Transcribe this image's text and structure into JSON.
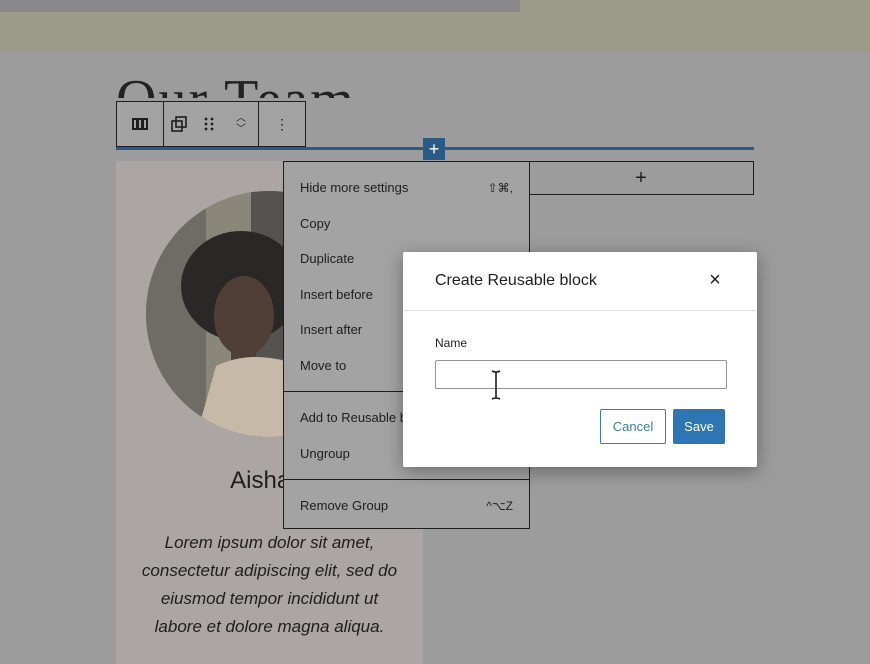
{
  "editor": {
    "heading": "Our Team",
    "appender_label": "+",
    "inserter_label": "+"
  },
  "toolbar": {
    "parent_icon": "columns-icon",
    "block_icon": "reusable-icon",
    "drag_icon": "drag-handle-icon",
    "more_label": "⋮"
  },
  "card": {
    "name": "Aisha J",
    "bio": "Lorem ipsum dolor sit amet, consectetur adipiscing elit, sed do eiusmod tempor incididunt ut labore et dolore magna aliqua."
  },
  "menu": {
    "groups": [
      {
        "items": [
          {
            "label": "Hide more settings",
            "shortcut": "⇧⌘,"
          },
          {
            "label": "Copy",
            "shortcut": ""
          },
          {
            "label": "Duplicate",
            "shortcut": ""
          },
          {
            "label": "Insert before",
            "shortcut": ""
          },
          {
            "label": "Insert after",
            "shortcut": ""
          },
          {
            "label": "Move to",
            "shortcut": ""
          }
        ]
      },
      {
        "items": [
          {
            "label": "Add to Reusable b",
            "shortcut": ""
          },
          {
            "label": "Ungroup",
            "shortcut": ""
          }
        ]
      },
      {
        "items": [
          {
            "label": "Remove Group",
            "shortcut": "^⌥Z"
          }
        ]
      }
    ]
  },
  "modal": {
    "title": "Create Reusable block",
    "close_label": "×",
    "name_label": "Name",
    "name_value": "",
    "cancel_label": "Cancel",
    "save_label": "Save"
  },
  "colors": {
    "accent": "#2d76b3",
    "overlay": "#9c9c9c"
  }
}
